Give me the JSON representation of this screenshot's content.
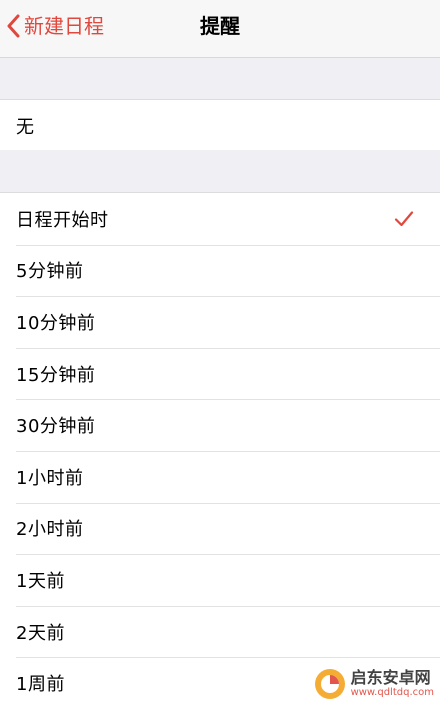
{
  "navbar": {
    "back_label": "新建日程",
    "title": "提醒"
  },
  "none_option": {
    "label": "无"
  },
  "options": [
    {
      "label": "日程开始时",
      "selected": true
    },
    {
      "label": "5分钟前"
    },
    {
      "label": "10分钟前"
    },
    {
      "label": "15分钟前"
    },
    {
      "label": "30分钟前"
    },
    {
      "label": "1小时前"
    },
    {
      "label": "2小时前"
    },
    {
      "label": "1天前"
    },
    {
      "label": "2天前"
    },
    {
      "label": "1周前"
    }
  ],
  "watermark": {
    "title": "启东安卓网",
    "url": "www.qdltdq.com"
  },
  "colors": {
    "accent": "#e0483e",
    "background": "#efeff4"
  },
  "icons": {
    "back": "chevron-left-icon",
    "selected": "checkmark-icon"
  }
}
